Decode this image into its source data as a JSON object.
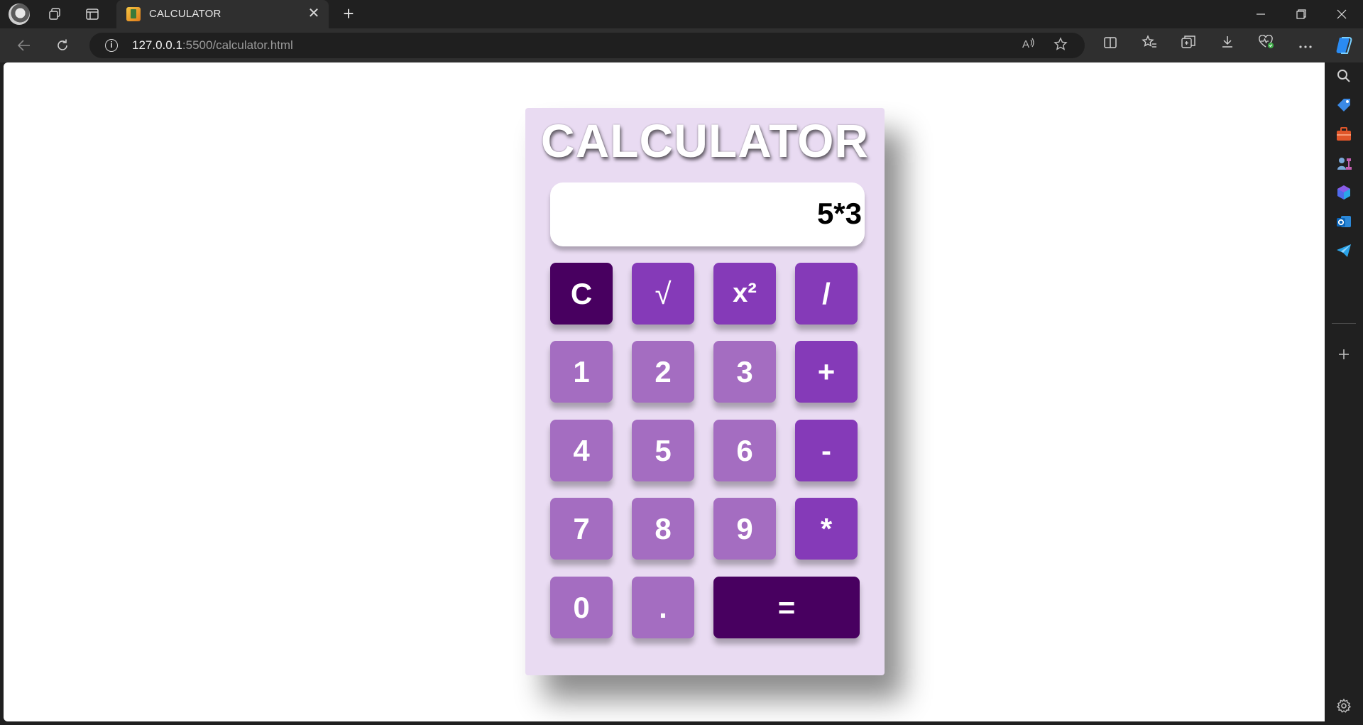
{
  "browser": {
    "tab_title": "CALCULATOR",
    "url_host": "127.0.0.1",
    "url_rest": ":5500/calculator.html",
    "close_glyph": "✕",
    "new_tab_glyph": "+"
  },
  "page": {
    "title": "CALCULATOR",
    "display_value": "5*3",
    "keys": {
      "clear": "C",
      "sqrt": "√",
      "square": "x²",
      "divide": "/",
      "one": "1",
      "two": "2",
      "three": "3",
      "plus": "+",
      "four": "4",
      "five": "5",
      "six": "6",
      "minus": "-",
      "seven": "7",
      "eight": "8",
      "nine": "9",
      "multiply": "*",
      "zero": "0",
      "dot": ".",
      "equals": "="
    }
  },
  "colors": {
    "panel": "#e9dbf2",
    "number_key": "#a46dc1",
    "operator_key": "#853ab8",
    "dark_key": "#480060"
  }
}
